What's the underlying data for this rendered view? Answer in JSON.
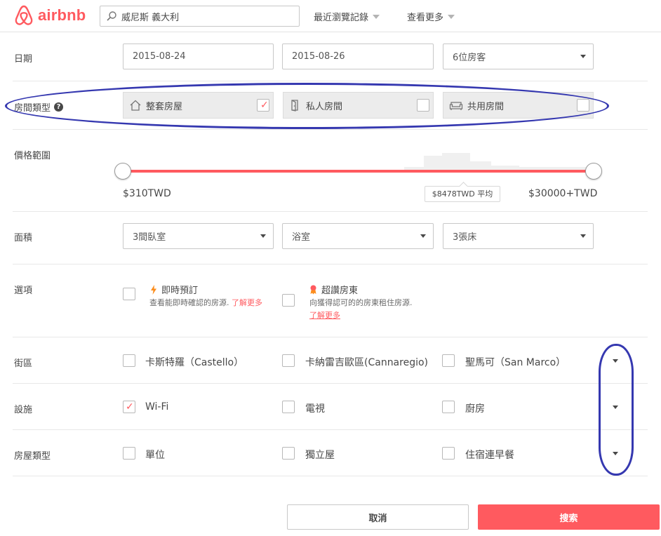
{
  "header": {
    "logo_text": "airbnb",
    "search_value": "威尼斯 義大利",
    "nav_recent": "最近瀏覽記錄",
    "nav_more": "查看更多"
  },
  "dates": {
    "label": "日期",
    "checkin": "2015-08-24",
    "checkout": "2015-08-26",
    "guests": "6位房客"
  },
  "room_type": {
    "label": "房間類型",
    "options": [
      {
        "label": "整套房屋",
        "checked": true,
        "icon": "house-icon"
      },
      {
        "label": "私人房間",
        "checked": false,
        "icon": "door-icon"
      },
      {
        "label": "共用房間",
        "checked": false,
        "icon": "sofa-icon"
      }
    ]
  },
  "price": {
    "label": "價格範圍",
    "min": "$310TWD",
    "max": "$30000+TWD",
    "average": "$8478TWD 平均"
  },
  "size": {
    "label": "面積",
    "bedrooms": "3間臥室",
    "bathrooms": "浴室",
    "beds": "3張床"
  },
  "options": {
    "label": "選項",
    "instant": {
      "title": "即時預訂",
      "desc": "查看能即時確認的房源.",
      "link": "了解更多",
      "checked": false
    },
    "superhost": {
      "title": "超讚房東",
      "desc": "向獲得認可的的房東租住房源.",
      "link": "了解更多",
      "checked": false
    }
  },
  "neighborhoods": {
    "label": "街區",
    "items": [
      {
        "label": "卡斯特羅（Castello）",
        "checked": false
      },
      {
        "label": "卡納雷吉歐區(Cannaregio)",
        "checked": false
      },
      {
        "label": "聖馬可（San Marco）",
        "checked": false
      }
    ]
  },
  "amenities": {
    "label": "設施",
    "items": [
      {
        "label": "Wi-Fi",
        "checked": true
      },
      {
        "label": "電視",
        "checked": false
      },
      {
        "label": "廚房",
        "checked": false
      }
    ]
  },
  "property_type": {
    "label": "房屋類型",
    "items": [
      {
        "label": "單位",
        "checked": false
      },
      {
        "label": "獨立屋",
        "checked": false
      },
      {
        "label": "住宿連早餐",
        "checked": false
      }
    ]
  },
  "buttons": {
    "cancel": "取消",
    "search": "搜索"
  },
  "colors": {
    "brand": "#ff5a5f",
    "annotation": "#3538b0"
  }
}
